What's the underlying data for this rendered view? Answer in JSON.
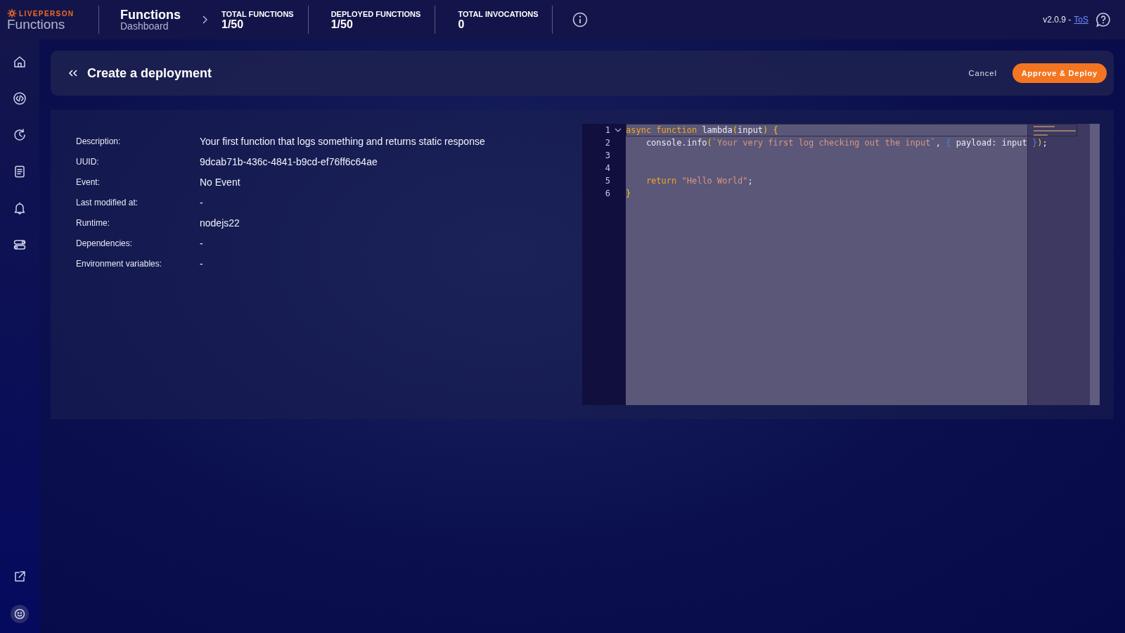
{
  "topbar": {
    "brand": "LIVEPERSON",
    "product": "Functions",
    "page_title": "Functions",
    "page_subtitle": "Dashboard",
    "stats": [
      {
        "label": "TOTAL FUNCTIONS",
        "value": "1/50"
      },
      {
        "label": "DEPLOYED FUNCTIONS",
        "value": "1/50"
      },
      {
        "label": "TOTAL INVOCATIONS",
        "value": "0"
      }
    ],
    "version": "v2.0.9 -",
    "tos_link": "ToS"
  },
  "sidebar": {
    "items": [
      {
        "selected": false
      },
      {
        "selected": false
      },
      {
        "selected": false
      },
      {
        "selected": false
      },
      {
        "selected": false
      },
      {
        "selected": false
      }
    ]
  },
  "header": {
    "title": "Create a deployment",
    "cancel": "Cancel",
    "primary": "Approve & Deploy"
  },
  "details": [
    {
      "label": "Description:",
      "value": "Your first function that logs something and returns static response"
    },
    {
      "label": "UUID:",
      "value": "9dcab71b-436c-4841-b9cd-ef76ff6c64ae"
    },
    {
      "label": "Event:",
      "value": "No Event"
    },
    {
      "label": "Last modified at:",
      "value": "-"
    },
    {
      "label": "Runtime:",
      "value": "nodejs22"
    },
    {
      "label": "Dependencies:",
      "value": "-"
    },
    {
      "label": "Environment variables:",
      "value": "-"
    }
  ],
  "editor": {
    "lines": [
      {
        "number": "1",
        "foldable": true,
        "current": true,
        "tokens": [
          {
            "kind": "keyword",
            "text": "async function "
          },
          {
            "kind": "plain",
            "text": "lambda"
          },
          {
            "kind": "bracket",
            "text": "("
          },
          {
            "kind": "plain",
            "text": "input"
          },
          {
            "kind": "bracket",
            "text": ") {"
          }
        ]
      },
      {
        "number": "2",
        "foldable": false,
        "current": false,
        "tokens": [
          {
            "kind": "plain",
            "text": "    console.info"
          },
          {
            "kind": "bracket",
            "text": "("
          },
          {
            "kind": "string",
            "text": "`Your very first log checking out the input`"
          },
          {
            "kind": "plain",
            "text": ", "
          },
          {
            "kind": "bracket2",
            "text": "{"
          },
          {
            "kind": "plain",
            "text": " payload: input "
          },
          {
            "kind": "bracket2",
            "text": "}"
          },
          {
            "kind": "bracket",
            "text": ")"
          },
          {
            "kind": "plain",
            "text": ";"
          }
        ]
      },
      {
        "number": "3",
        "foldable": false,
        "current": false
      },
      {
        "number": "4",
        "foldable": false,
        "current": false
      },
      {
        "number": "5",
        "foldable": false,
        "current": false,
        "tokens": [
          {
            "kind": "keyword",
            "text": "    return "
          },
          {
            "kind": "string",
            "text": "\"Hello World\""
          },
          {
            "kind": "plain",
            "text": ";"
          }
        ]
      },
      {
        "number": "6",
        "foldable": false,
        "current": false,
        "tokens": [
          {
            "kind": "bracket",
            "text": "}"
          }
        ]
      }
    ]
  }
}
